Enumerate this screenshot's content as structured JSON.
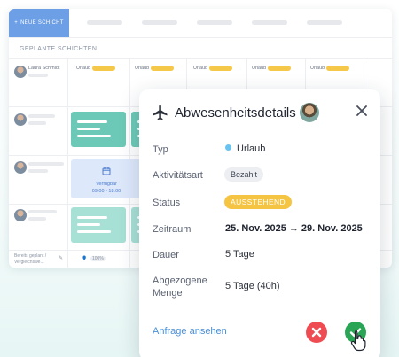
{
  "scheduler": {
    "new_shift_label": "NEUE SCHICHT",
    "section_label": "GEPLANTE SCHICHTEN",
    "employee_name": "Laura Schmidt",
    "leave_label": "Urlaub",
    "availability_label": "Verfügbar",
    "availability_time": "09:00 - 18:00",
    "footer_text": "Bereits geplant / Vergleichswe...",
    "footer_percent": "100%"
  },
  "popup": {
    "title": "Abwesenheitsdetails",
    "type_label": "Typ",
    "type_value": "Urlaub",
    "type_color": "#69c3ee",
    "activity_label": "Aktivitätsart",
    "activity_value": "Bezahlt",
    "status_label": "Status",
    "status_value": "AUSSTEHEND",
    "status_color": "#f5c443",
    "period_label": "Zeitraum",
    "period_start": "25. Nov. 2025",
    "period_end": "29. Nov. 2025",
    "duration_label": "Dauer",
    "duration_value": "5 Tage",
    "deducted_label_1": "Abgezogene",
    "deducted_label_2": "Menge",
    "deducted_value": "5 Tage (40h)",
    "view_request_link": "Anfrage ansehen",
    "icons": [
      "airplane-icon",
      "close-icon",
      "reject-x-icon",
      "approve-check-icon",
      "hand-cursor-icon"
    ],
    "reject_color": "#ee4b53",
    "approve_color": "#2aa556"
  }
}
